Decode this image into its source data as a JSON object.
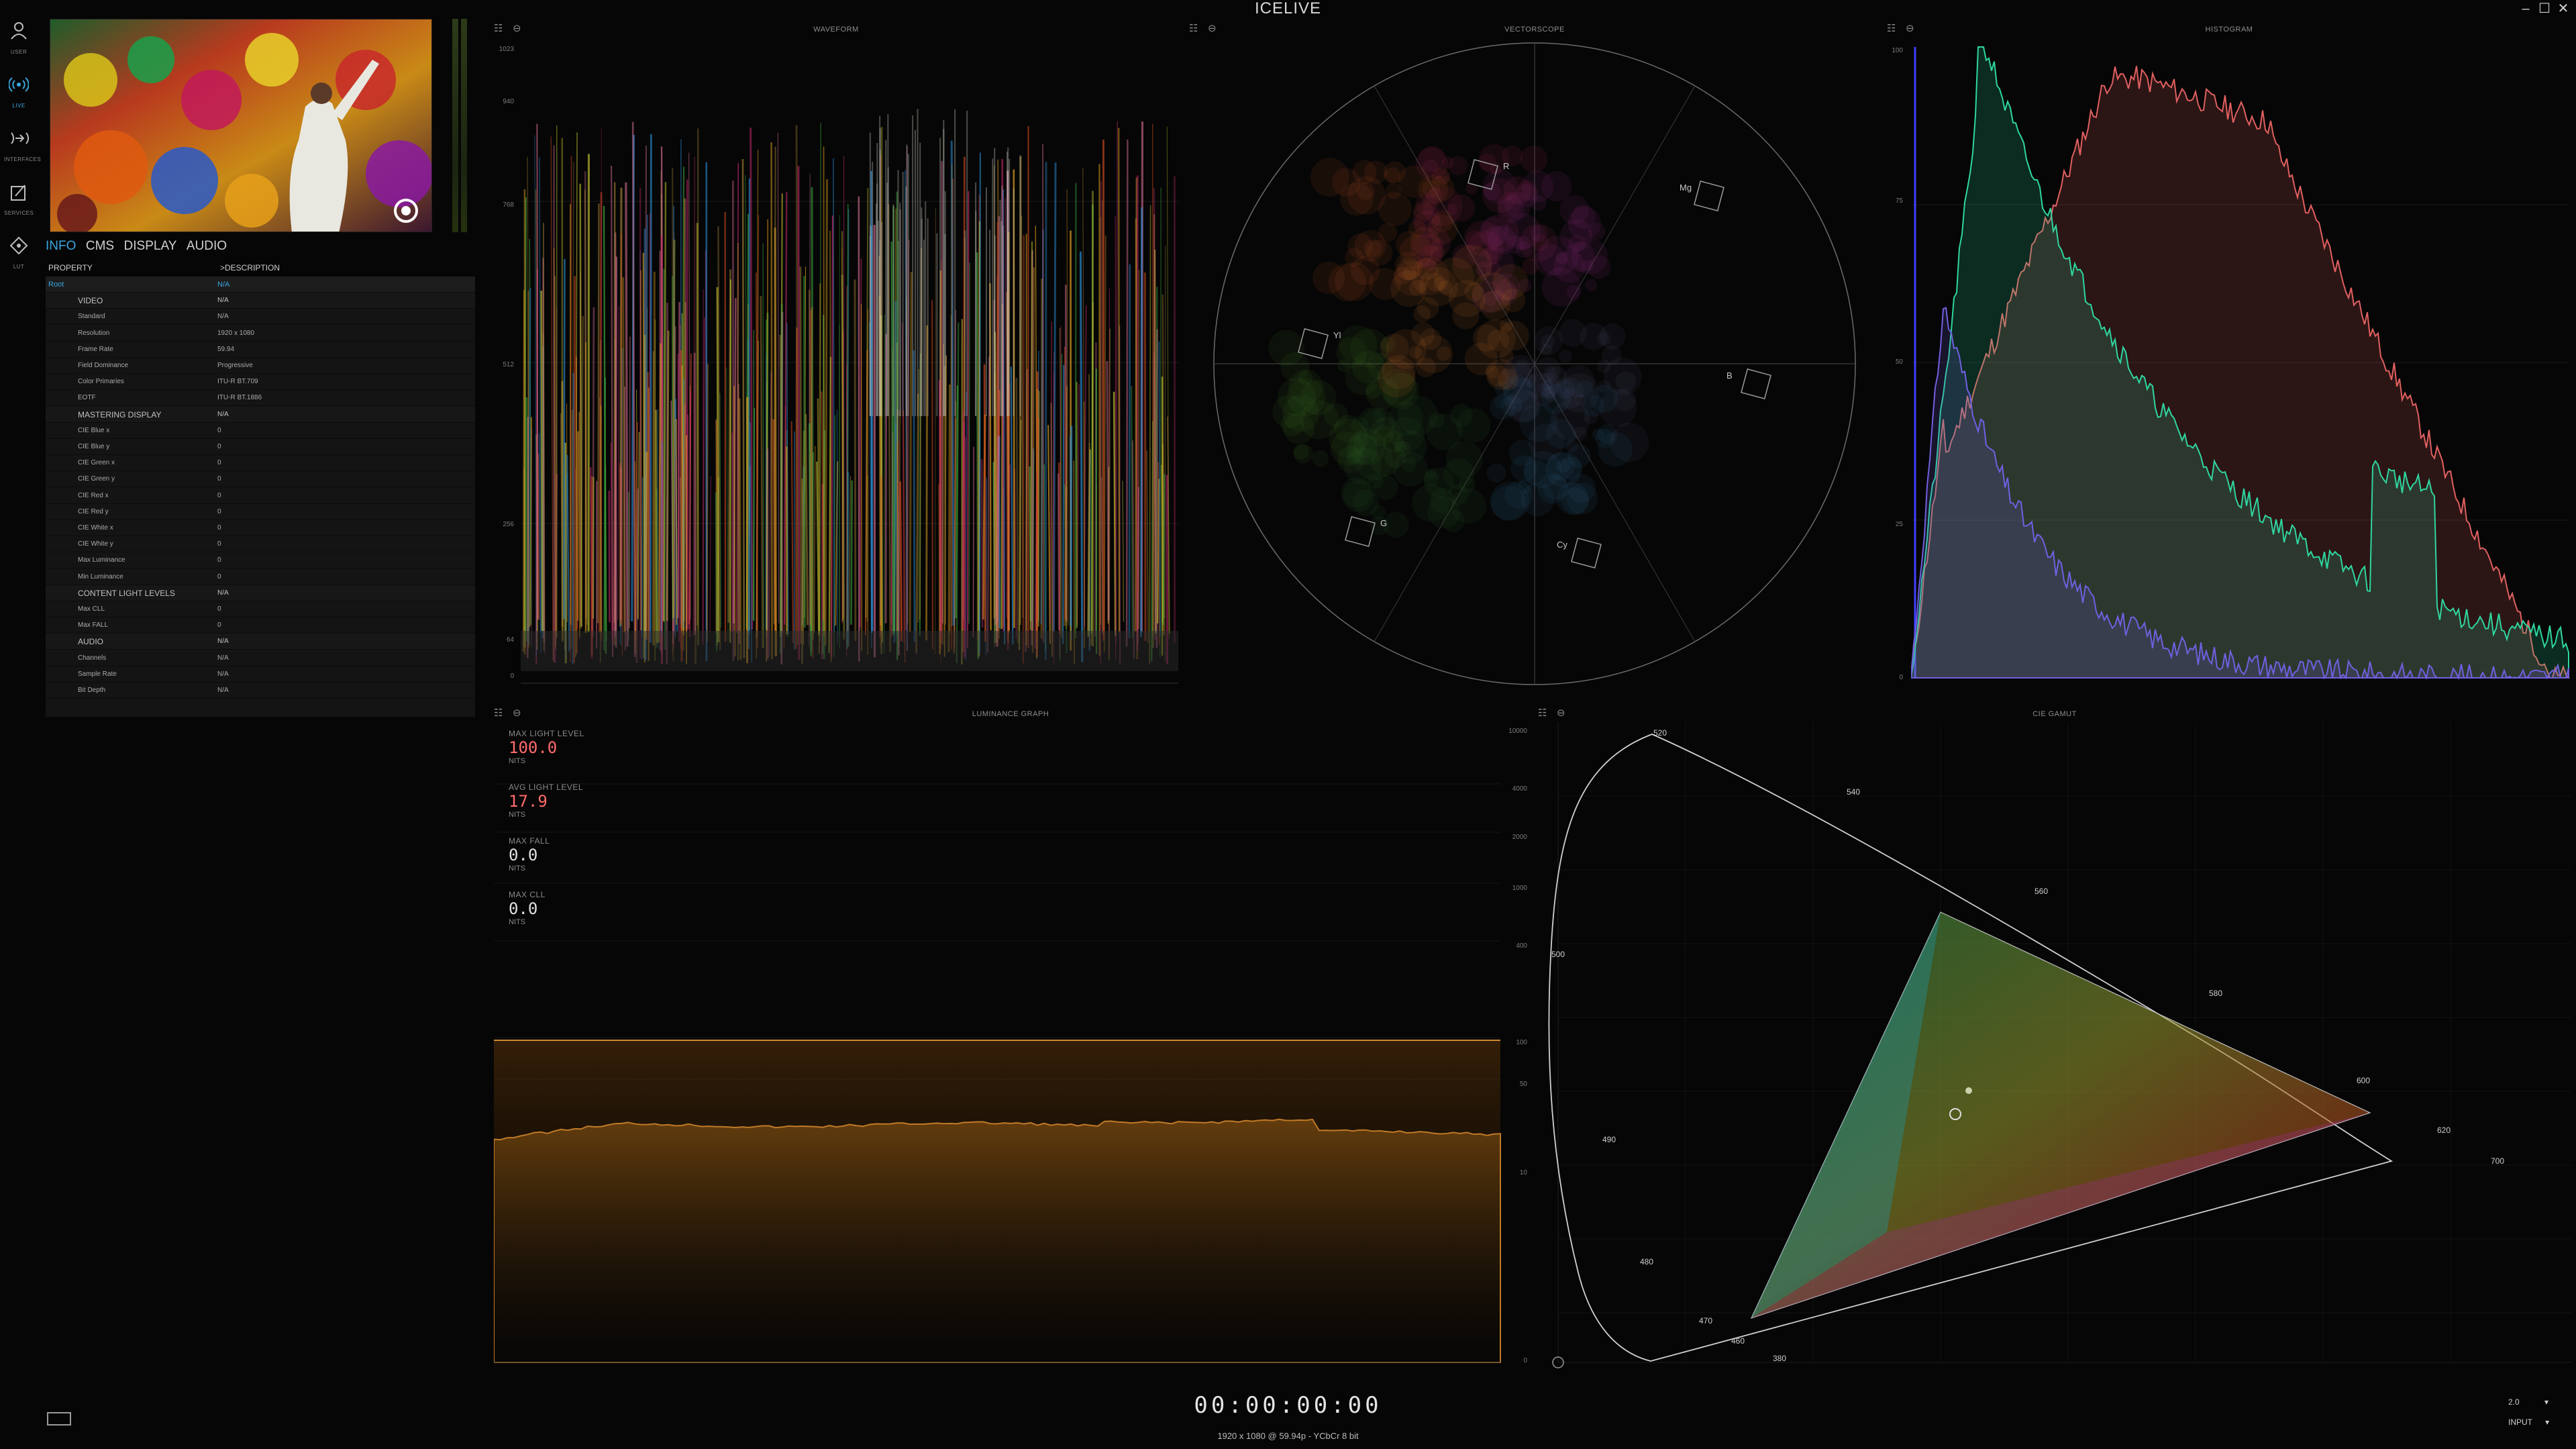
{
  "app": {
    "title": "ICELIVE"
  },
  "window": {
    "minimize": "–",
    "restore": "☐",
    "close": "✕"
  },
  "nav": [
    {
      "label": "USER",
      "icon": "user-icon"
    },
    {
      "label": "LIVE",
      "icon": "broadcast-icon",
      "active": true
    },
    {
      "label": "INTERFACES",
      "icon": "interfaces-icon"
    },
    {
      "label": "SERVICES",
      "icon": "services-icon"
    },
    {
      "label": "LUT",
      "icon": "lut-icon"
    }
  ],
  "info": {
    "tabs": [
      "INFO",
      "CMS",
      "DISPLAY",
      "AUDIO"
    ],
    "active_tab": "INFO",
    "columns": [
      "PROPERTY",
      ">DESCRIPTION"
    ],
    "rows": [
      {
        "type": "root",
        "key": "Root",
        "value": "N/A"
      },
      {
        "type": "section",
        "key": "VIDEO",
        "value": "N/A"
      },
      {
        "type": "item",
        "key": "Standard",
        "value": "N/A"
      },
      {
        "type": "item",
        "key": "Resolution",
        "value": "1920 x 1080"
      },
      {
        "type": "item",
        "key": "Frame Rate",
        "value": "59.94"
      },
      {
        "type": "item",
        "key": "Field Dominance",
        "value": "Progressive"
      },
      {
        "type": "item",
        "key": "Color Primaries",
        "value": "ITU-R BT.709"
      },
      {
        "type": "item",
        "key": "EOTF",
        "value": "ITU-R BT.1886"
      },
      {
        "type": "section",
        "key": "MASTERING DISPLAY",
        "value": "N/A"
      },
      {
        "type": "item",
        "key": "CIE Blue x",
        "value": "0"
      },
      {
        "type": "item",
        "key": "CIE Blue y",
        "value": "0"
      },
      {
        "type": "item",
        "key": "CIE Green x",
        "value": "0"
      },
      {
        "type": "item",
        "key": "CIE Green y",
        "value": "0"
      },
      {
        "type": "item",
        "key": "CIE Red x",
        "value": "0"
      },
      {
        "type": "item",
        "key": "CIE Red y",
        "value": "0"
      },
      {
        "type": "item",
        "key": "CIE White x",
        "value": "0"
      },
      {
        "type": "item",
        "key": "CIE White y",
        "value": "0"
      },
      {
        "type": "item",
        "key": "Max Luminance",
        "value": "0"
      },
      {
        "type": "item",
        "key": "Min Luminance",
        "value": "0"
      },
      {
        "type": "section",
        "key": "CONTENT LIGHT LEVELS",
        "value": "N/A"
      },
      {
        "type": "item",
        "key": "Max CLL",
        "value": "0"
      },
      {
        "type": "item",
        "key": "Max FALL",
        "value": "0"
      },
      {
        "type": "section",
        "key": "AUDIO",
        "value": "N/A"
      },
      {
        "type": "item",
        "key": "Channels",
        "value": "N/A"
      },
      {
        "type": "item",
        "key": "Sample Rate",
        "value": "N/A"
      },
      {
        "type": "item",
        "key": "Bit Depth",
        "value": "N/A"
      }
    ]
  },
  "waveform": {
    "title": "WAVEFORM",
    "axis": [
      "1023",
      "940",
      "768",
      "512",
      "256",
      "64",
      "0"
    ]
  },
  "vectorscope": {
    "title": "VECTORSCOPE",
    "targets": [
      "R",
      "Mg",
      "B",
      "Cy",
      "G",
      "Yl"
    ]
  },
  "histogram": {
    "title": "HISTOGRAM",
    "axis": [
      "100",
      "75",
      "50",
      "25",
      "0"
    ],
    "colors": {
      "red": "#e06060",
      "green": "#2fd6a0",
      "blue": "#7060e0"
    }
  },
  "luminance": {
    "title": "LUMINANCE GRAPH",
    "stats": [
      {
        "label": "MAX LIGHT LEVEL",
        "value": "100.0",
        "unit": "NITS",
        "highlight": true
      },
      {
        "label": "AVG LIGHT LEVEL",
        "value": "17.9",
        "unit": "NITS",
        "highlight": true
      },
      {
        "label": "MAX FALL",
        "value": "0.0",
        "unit": "NITS",
        "highlight": false
      },
      {
        "label": "MAX CLL",
        "value": "0.0",
        "unit": "NITS",
        "highlight": false
      }
    ],
    "axis": [
      "10000",
      "4000",
      "2000",
      "1000",
      "400",
      "100",
      "50",
      "10",
      "0"
    ],
    "max_nits": 100.0,
    "avg_nits": 17.9
  },
  "cie": {
    "title": "CIE GAMUT",
    "wavelengths": [
      "520",
      "540",
      "560",
      "580",
      "600",
      "620",
      "700",
      "500",
      "490",
      "480",
      "470",
      "460",
      "380"
    ]
  },
  "footer": {
    "timecode": "00:00:00:00",
    "status": "1920 x 1080 @ 59.94p - YCbCr 8 bit",
    "gamma": "2.0",
    "source": "INPUT"
  }
}
